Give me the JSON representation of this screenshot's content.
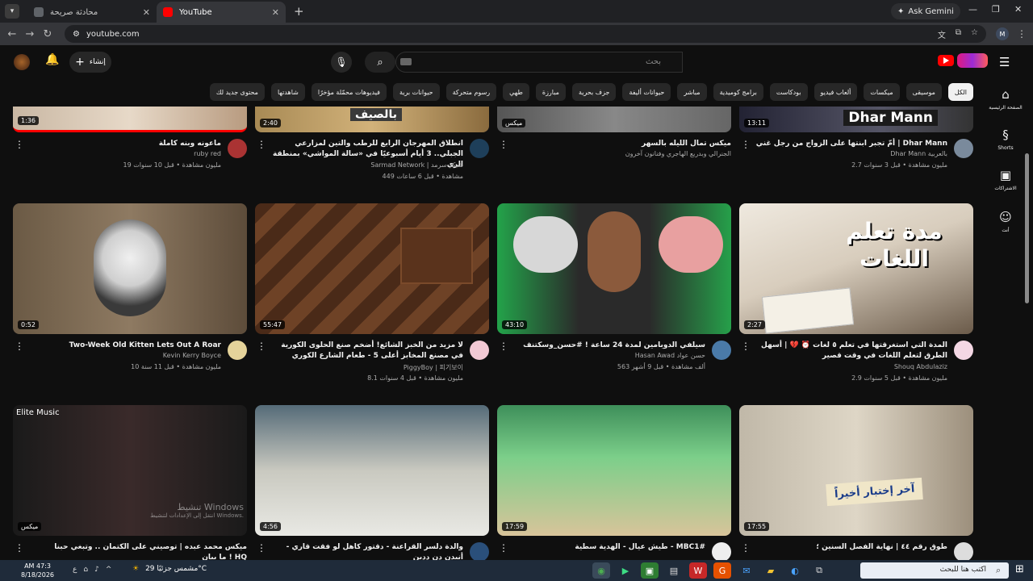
{
  "browser": {
    "tabs": [
      {
        "label": "محادثة صريحة",
        "favicon_color": "#5f6368"
      },
      {
        "label": "YouTube",
        "favicon_color": "#ff0000"
      }
    ],
    "gemini_label": "Ask Gemini",
    "url": "youtube.com",
    "profile_initial": "M"
  },
  "youtube": {
    "search_placeholder": "بحث",
    "create_label": "إنشاء",
    "chips": [
      "الكل",
      "موسيقى",
      "ميكسات",
      "ألعاب فيديو",
      "بودكاست",
      "برامج كوميدية",
      "مباشر",
      "حيوانات أليفة",
      "جزف بحرية",
      "مبارزة",
      "طهي",
      "رسوم متحركة",
      "حيوانات برية",
      "فيديوهات محمّلة مؤخرًا",
      "شاهدتها",
      "محتوى جديد لك"
    ],
    "sidebar": [
      {
        "icon": "home-icon",
        "glyph": "⌂",
        "label": "الصفحة الرئيسية"
      },
      {
        "icon": "shorts-icon",
        "glyph": "§",
        "label": "Shorts"
      },
      {
        "icon": "subscriptions-icon",
        "glyph": "▣",
        "label": "الاشتراكات"
      },
      {
        "icon": "you-icon",
        "glyph": "☺",
        "label": "أنت"
      }
    ],
    "top_row": [
      {
        "title": "أمّ تجبر ابنتها على الزواج من رجل غني | Dhar Mann",
        "channel": "Dhar Mann بالعربية",
        "stats": "2.7 مليون مشاهدة • قبل 3 سنوات",
        "duration": "13:11",
        "thumb_text": "Dhar Mann"
      },
      {
        "title": "ميكس تمال الليله بالسهر",
        "channel": "الجنرالي وبدريع الهاجري وفنانون آخرون",
        "stats": "",
        "duration": "ميكس",
        "thumb_text": ""
      },
      {
        "title": "انطلاق المهرجان الرابع للرطب والتين لمزارعي الجبلي.. 3 أيام أسبوعيًا في «سالة المواشي» بمنطقة الري",
        "channel": "Sarmad Network | شبكة سرمد",
        "stats": "449 مشاهدة • قبل 6 ساعات",
        "duration": "2:40",
        "thumb_text": "بالصيف"
      },
      {
        "title": "ماعونه وبنه كاملة",
        "channel": "ruby red",
        "stats": "19 مليون مشاهدة • قبل 10 سنوات",
        "duration": "1:36",
        "thumb_text": ""
      }
    ],
    "mid_row": [
      {
        "title": "المدة التي استغرقتها في تعلم ٥ لغات ⏰ 💔 | أسهل الطرق لتعلم اللغات في وقت قصير",
        "channel": "Shouq Abdulaziz",
        "stats": "2.9 مليون مشاهدة • قبل 5 سنوات",
        "duration": "2:27",
        "thumb_text": "مدة تعلم اللغات"
      },
      {
        "title": "سيلفي الدوبامين لمدة 24 ساعة ! #حسن_وسكتنف",
        "channel": "Hasan Awad حسن عواد",
        "stats": "563 ألف مشاهدة • قبل 9 أشهر",
        "duration": "43:10",
        "thumb_text": ""
      },
      {
        "title": "لا مزيد من الخبز الشائع! أضخم صنع الحلوى الكورية في مصنع المخابز أعلى 5 - طعام الشارع الكوري",
        "channel": "PiggyBoy | 피기보이",
        "stats": "8.1 مليون مشاهدة • قبل 4 سنوات",
        "duration": "55:47",
        "thumb_text": ""
      },
      {
        "title": "Two-Week Old Kitten Lets Out A Roar",
        "channel": "Kevin Kerry Boyce",
        "stats": "10 مليون مشاهدة • قبل 11 سنة",
        "duration": "0:52",
        "thumb_text": ""
      }
    ],
    "bottom_row": [
      {
        "title": "طوق رقم ٤٤ | نهاية الفصل السنين ؛",
        "channel": "",
        "stats": "",
        "duration": "17:55",
        "thumb_text": "آخر إختبار أخيراً"
      },
      {
        "title": "طيش عيال - الهدية سطية - MBC1#",
        "channel": "",
        "stats": "",
        "duration": "17:59",
        "thumb_text": ""
      },
      {
        "title": "والدة دلسر القراعنة - دقتور كاهل لو فقت قاري - أنبدن دن ددين",
        "channel": "",
        "stats": "",
        "duration": "4:56",
        "thumb_text": ""
      },
      {
        "title": "ميكس محمد عبده | توصيني على الكتمان .. وتبغي حبنا ما يبان ! HQ",
        "channel": "",
        "stats": "",
        "duration": "ميكس",
        "thumb_text": "Elite Music"
      }
    ]
  },
  "windows_overlay": {
    "line1": "تنشيط Windows",
    "line2": "انتقل إلى الإعدادات لتنشيط Windows."
  },
  "taskbar": {
    "time": "AM 47:3",
    "date": "8/18/2026",
    "weather": "مشمس جزئيًا 29°C",
    "search_placeholder": "اكتب هنا للبحث"
  }
}
